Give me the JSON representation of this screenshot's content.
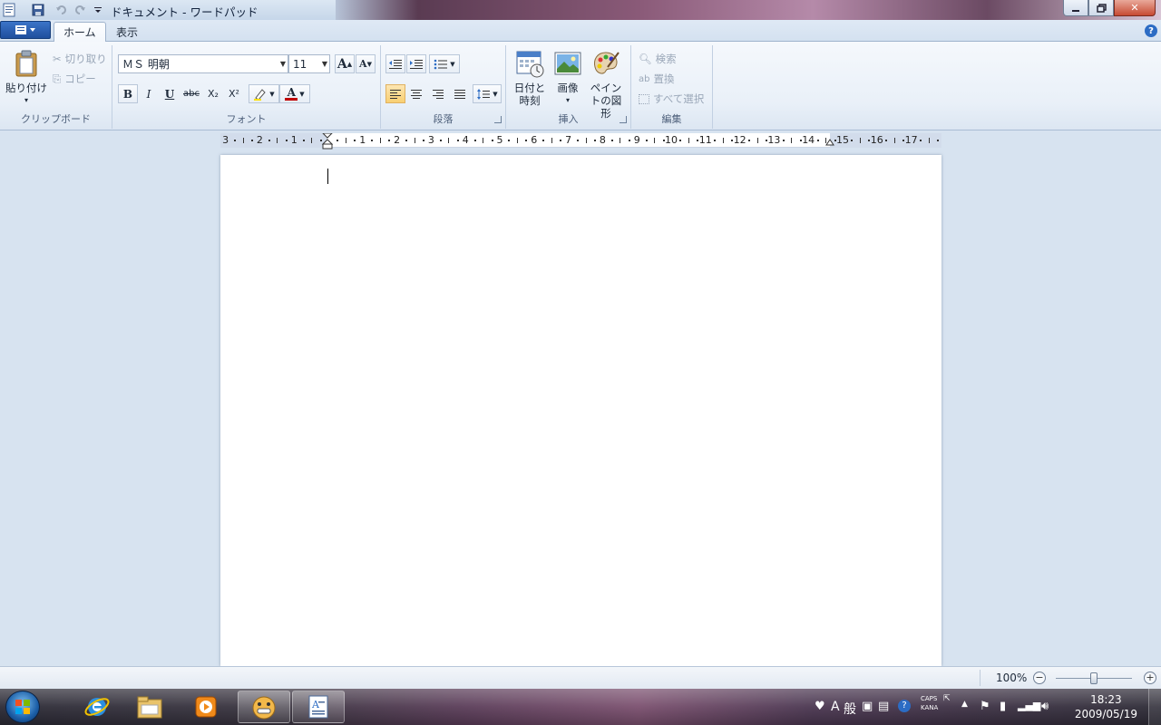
{
  "window": {
    "title": "ドキュメント - ワードパッド",
    "minimize_icon": "minimize-icon",
    "maximize_icon": "restore-icon",
    "close_icon": "close-icon"
  },
  "tabs": [
    {
      "label": "ホーム",
      "active": true
    },
    {
      "label": "表示",
      "active": false
    }
  ],
  "clipboard": {
    "paste": "貼り付け",
    "cut": "切り取り",
    "copy": "コピー",
    "label": "クリップボード"
  },
  "font": {
    "family": "ＭＳ 明朝",
    "size": "11",
    "bold": "B",
    "italic": "I",
    "underline": "U",
    "strike": "abc",
    "subscript": "X₂",
    "superscript": "X²",
    "grow": "A",
    "shrink": "A",
    "color_letter": "A",
    "label": "フォント"
  },
  "paragraph": {
    "label": "段落"
  },
  "insert": {
    "datetime": "日付と時刻",
    "picture": "画像",
    "paint": "ペイントの図形",
    "label": "挿入"
  },
  "editing": {
    "find": "検索",
    "replace": "置換",
    "select_all": "すべて選択",
    "label": "編集"
  },
  "ruler": {
    "labels": [
      "3",
      "2",
      "1",
      "1",
      "2",
      "3",
      "4",
      "5",
      "6",
      "7",
      "8",
      "9",
      "10",
      "11",
      "12",
      "13",
      "14",
      "15",
      "16",
      "17"
    ]
  },
  "status": {
    "zoom": "100%",
    "zoom_level": 0.5
  },
  "taskbar": {
    "time": "18:23",
    "date": "2009/05/19",
    "caps": "CAPS",
    "kana": "KANA",
    "ime_a": "A",
    "ime_mode": "般"
  },
  "colors": {
    "accent": "#2c6cc4",
    "selected_button": "#f8cf72",
    "font_color_bar": "#c00000"
  }
}
